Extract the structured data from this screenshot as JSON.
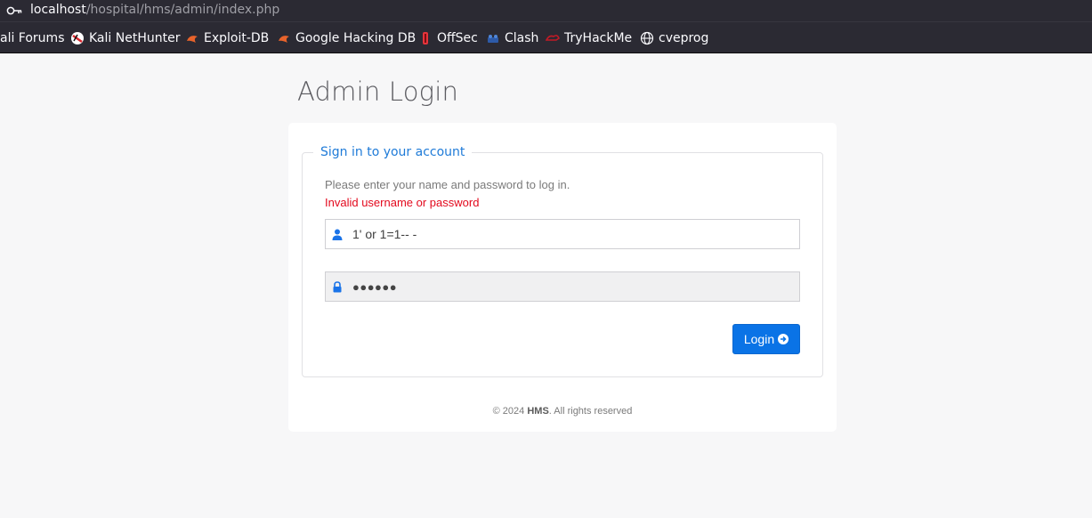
{
  "browser": {
    "url_host": "localhost",
    "url_path": "/hospital/hms/admin/index.php",
    "bookmarks": [
      {
        "label": "ali Forums",
        "icon": "kali-forums-icon"
      },
      {
        "label": "Kali NetHunter",
        "icon": "nethunter-icon"
      },
      {
        "label": "Exploit-DB",
        "icon": "exploit-db-icon"
      },
      {
        "label": "Google Hacking DB",
        "icon": "ghdb-icon"
      },
      {
        "label": "OffSec",
        "icon": "offsec-icon"
      },
      {
        "label": "Clash",
        "icon": "clash-icon"
      },
      {
        "label": "TryHackMe",
        "icon": "tryhackme-icon"
      },
      {
        "label": "cveprog",
        "icon": "globe-icon"
      }
    ]
  },
  "page": {
    "title": "Admin Login",
    "legend": "Sign in to your account",
    "hint": "Please enter your name and password to log in.",
    "error": "Invalid username or password",
    "username_value": "1' or 1=1-- -",
    "password_value": "●●●●●●",
    "login_label": "Login",
    "footer_prefix": "© 2024",
    "footer_brand": "HMS",
    "footer_suffix": ". All rights reserved"
  },
  "colors": {
    "accent": "#0a73e6",
    "error": "#e3091d",
    "legend": "#1f7bd8"
  }
}
